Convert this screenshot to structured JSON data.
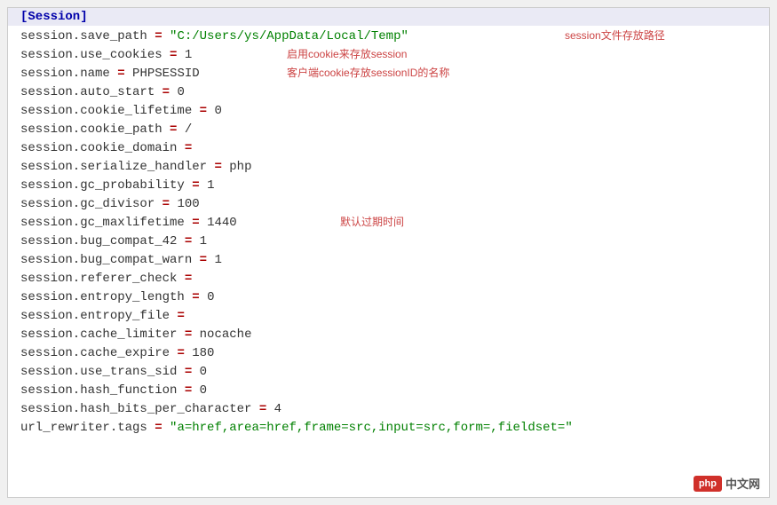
{
  "section": "[Session]",
  "lines": [
    {
      "key": "session.save_path",
      "eq": "=",
      "value": "\"C:/Users/ys/AppData/Local/Temp\"",
      "isString": true,
      "annot": "session文件存放路径",
      "annotClass": "annot1"
    },
    {
      "key": "session.use_cookies",
      "eq": "=",
      "value": "1",
      "annot": "启用cookie来存放session",
      "annotClass": "annot2"
    },
    {
      "key": "session.name",
      "eq": "=",
      "value": "PHPSESSID",
      "annot": "客户端cookie存放sessionID的名称",
      "annotClass": "annot3"
    },
    {
      "key": "session.auto_start",
      "eq": "=",
      "value": "0"
    },
    {
      "key": "session.cookie_lifetime",
      "eq": "=",
      "value": "0"
    },
    {
      "key": "session.cookie_path",
      "eq": "=",
      "value": "/"
    },
    {
      "key": "session.cookie_domain",
      "eq": "=",
      "value": ""
    },
    {
      "key": "session.serialize_handler",
      "eq": "=",
      "value": "php"
    },
    {
      "key": "session.gc_probability",
      "eq": "=",
      "value": "1"
    },
    {
      "key": "session.gc_divisor    ",
      "eq": "=",
      "value": "100"
    },
    {
      "key": "session.gc_maxlifetime",
      "eq": "=",
      "value": "1440",
      "annot": "默认过期时间",
      "annotClass": "annot4"
    },
    {
      "key": "session.bug_compat_42",
      "eq": "=",
      "value": "1"
    },
    {
      "key": "session.bug_compat_warn",
      "eq": "=",
      "value": "1"
    },
    {
      "key": "session.referer_check",
      "eq": "=",
      "value": ""
    },
    {
      "key": "session.entropy_length",
      "eq": "=",
      "value": "0"
    },
    {
      "key": "session.entropy_file",
      "eq": "=",
      "value": ""
    },
    {
      "key": "session.cache_limiter",
      "eq": "=",
      "value": "nocache"
    },
    {
      "key": "session.cache_expire",
      "eq": "=",
      "value": "180"
    },
    {
      "key": "session.use_trans_sid",
      "eq": "=",
      "value": "0"
    },
    {
      "key": "session.hash_function",
      "eq": "=",
      "value": "0"
    },
    {
      "key": "session.hash_bits_per_character",
      "eq": "=",
      "value": "4"
    },
    {
      "key": "url_rewriter.tags",
      "eq": "=",
      "value": "\"a=href,area=href,frame=src,input=src,form=,fieldset=\"",
      "isString": true
    }
  ],
  "logo": {
    "badge": "php",
    "text": "中文网"
  }
}
